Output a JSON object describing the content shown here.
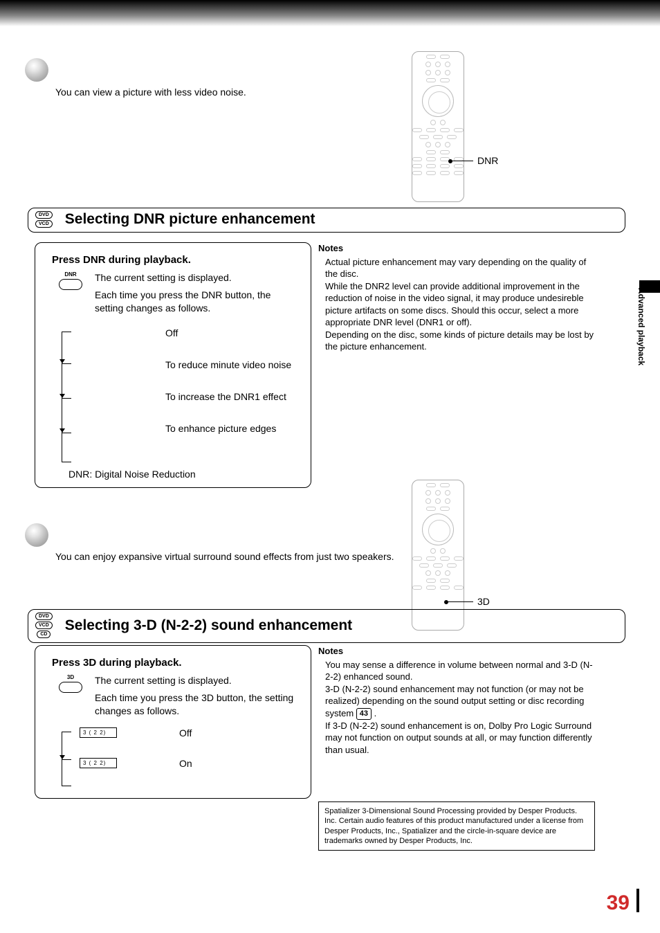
{
  "intro": {
    "dnr": "You can view a picture with less video noise.",
    "sound": "You can enjoy expansive virtual surround sound effects from just two speakers."
  },
  "remote_callouts": {
    "dnr": "DNR",
    "threeD": "3D"
  },
  "sections": {
    "dnr": {
      "badges": [
        "DVD",
        "VCD"
      ],
      "title": "Selecting DNR picture enhancement",
      "instr_title": "Press DNR during playback.",
      "btn_label": "DNR",
      "line1": "The current setting is displayed.",
      "line2": "Each time you press the DNR button, the setting changes as follows.",
      "states": [
        {
          "desc": "Off"
        },
        {
          "desc": "To reduce minute video noise"
        },
        {
          "desc": "To increase the DNR1 effect"
        },
        {
          "desc": "To enhance picture edges"
        }
      ],
      "footnote": "DNR: Digital Noise Reduction"
    },
    "sound": {
      "badges": [
        "DVD",
        "VCD",
        "CD"
      ],
      "title": "Selecting 3-D (N-2-2) sound enhancement",
      "instr_title": "Press 3D during playback.",
      "btn_label": "3D",
      "line1": "The current setting is displayed.",
      "line2": "Each time you press the 3D button, the setting changes as follows.",
      "states": [
        {
          "box": "3 (  2 2)",
          "desc": "Off"
        },
        {
          "box": "3 (  2 2)",
          "desc": "On"
        }
      ]
    }
  },
  "notes": {
    "heading": "Notes",
    "dnr": [
      "Actual picture enhancement may vary depending on the quality of the disc.",
      "While the DNR2 level can provide additional improvement in the reduction of noise in the video signal, it may produce undesireble picture artifacts on some discs. Should this occur, select a more appropriate DNR level (DNR1 or off).",
      "Depending on the disc, some kinds of picture details may be lost by the picture enhancement."
    ],
    "sound_pre": "You may sense a difference in volume between normal and 3-D (N-2-2) enhanced sound.",
    "sound_mid_a": "3-D (N-2-2) sound enhancement may not function (or may not be realized) depending on the sound output setting or disc recording system ",
    "sound_ref": "43",
    "sound_mid_b": ".",
    "sound_post": "If 3-D (N-2-2) sound enhancement is on, Dolby Pro Logic Surround may not function on output sounds at all, or may function differently than usual."
  },
  "trademark": "Spatializer   3-Dimensional Sound Processing provided by Desper Products. Inc.\nCertain audio features of this product manufactured under a license from Desper Products, Inc., Spatializer   and the circle-in-square device are trademarks owned by Desper Products, Inc.",
  "sidebar": "Advanced playback",
  "page_number": "39"
}
